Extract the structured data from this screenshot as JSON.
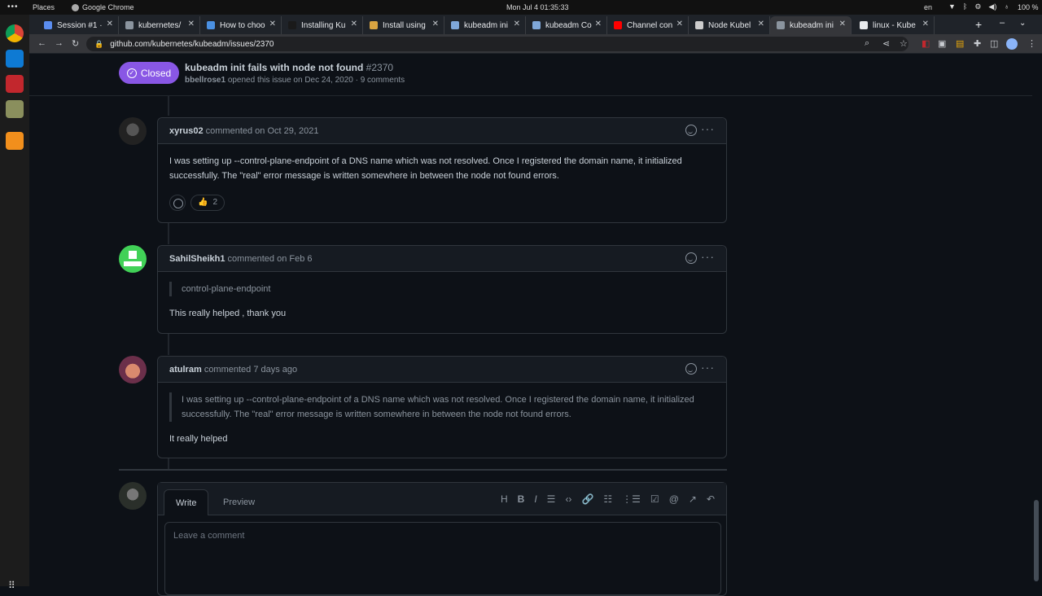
{
  "os": {
    "activities": "•••",
    "places": "Places",
    "app_name": "Google Chrome",
    "clock": "Mon Jul 4  01:35:33",
    "lang": "en",
    "battery": "100 %"
  },
  "tabs": [
    {
      "label": "Session #1 ·",
      "color": "#5b8def"
    },
    {
      "label": "kubernetes/",
      "color": "#8b949e"
    },
    {
      "label": "How to choo",
      "color": "#4a90e2"
    },
    {
      "label": "Installing Ku",
      "color": "#1a1a1a"
    },
    {
      "label": "Install using",
      "color": "#d9a441"
    },
    {
      "label": "kubeadm ini",
      "color": "#7fa7d9"
    },
    {
      "label": "kubeadm Co",
      "color": "#7fa7d9"
    },
    {
      "label": "Channel con",
      "color": "#ff0000"
    },
    {
      "label": "Node Kubel",
      "color": "#cccccc"
    },
    {
      "label": "kubeadm ini",
      "color": "#8b949e"
    },
    {
      "label": "linux - Kube",
      "color": "#e8eaed"
    }
  ],
  "omnibox": {
    "url": "github.com/kubernetes/kubeadm/issues/2370"
  },
  "issue": {
    "state": "Closed",
    "title": "kubeadm init fails with node not found",
    "number": "#2370",
    "author": "bbellrose1",
    "meta": "opened this issue on Dec 24, 2020 · 9 comments"
  },
  "comments": [
    {
      "author": "xyrus02",
      "when": "commented on Oct 29, 2021",
      "body": "I was setting up --control-plane-endpoint of a DNS name which was not resolved. Once I registered the domain name, it initialized successfully. The \"real\" error message is written somewhere in between the node not found errors.",
      "reaction_emoji": "👍",
      "reaction_count": "2"
    },
    {
      "author": "SahilSheikh1",
      "when": "commented on Feb 6",
      "quote": "control-plane-endpoint",
      "body": "This really helped , thank you"
    },
    {
      "author": "atulram",
      "when": "commented 7 days ago",
      "quote": "I was setting up --control-plane-endpoint of a DNS name which was not resolved. Once I registered the domain name, it initialized successfully. The \"real\" error message is written somewhere in between the node not found errors.",
      "body": "It really helped"
    }
  ],
  "editor": {
    "write_tab": "Write",
    "preview_tab": "Preview",
    "placeholder": "Leave a comment",
    "tools": [
      "H",
      "B",
      "I",
      "☰",
      "‹›",
      "🔗",
      "☷",
      "⋮☰",
      "☑",
      "@",
      "↗",
      "↶"
    ]
  }
}
